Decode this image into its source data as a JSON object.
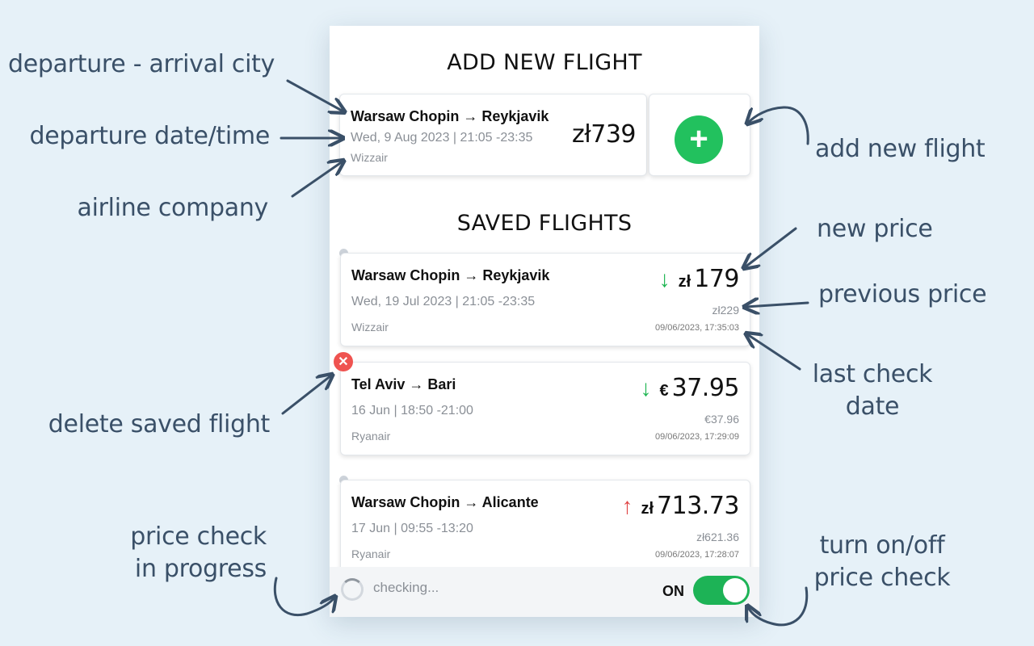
{
  "annotations": {
    "departure_arrival": "departure - arrival city",
    "departure_date": "departure date/time",
    "airline": "airline company",
    "delete": "delete saved flight",
    "in_progress_1": "price check",
    "in_progress_2": "in progress",
    "add_new": "add new flight",
    "new_price": "new price",
    "previous_price": "previous price",
    "last_check_1": "last check",
    "last_check_2": "date",
    "toggle_1": "turn on/off",
    "toggle_2": "price check"
  },
  "popup": {
    "add_heading": "ADD NEW FLIGHT",
    "saved_heading": "SAVED FLIGHTS",
    "new_flight": {
      "route": "Warsaw Chopin → Reykjavik",
      "date": "Wed, 9 Aug 2023 | 21:05 -23:35",
      "airline": "Wizzair",
      "price": "zł739"
    },
    "add_button_icon": "+",
    "saved": [
      {
        "route": "Warsaw Chopin → Reykjavik",
        "date": "Wed, 19 Jul 2023 | 21:05 -23:35",
        "airline": "Wizzair",
        "trend_icon": "↓",
        "trend": "down",
        "currency": "zł",
        "price": "179",
        "previous": "zł229",
        "checked": "09/06/2023, 17:35:03"
      },
      {
        "route": "Tel Aviv → Bari",
        "date": "16 Jun | 18:50 -21:00",
        "airline": "Ryanair",
        "trend_icon": "↓",
        "trend": "down",
        "currency": "€",
        "price": "37.95",
        "previous": "€37.96",
        "checked": "09/06/2023, 17:29:09"
      },
      {
        "route": "Warsaw Chopin → Alicante",
        "date": "17 Jun | 09:55 -13:20",
        "airline": "Ryanair",
        "trend_icon": "↑",
        "trend": "up",
        "currency": "zł",
        "price": "713.73",
        "previous": "zł621.36",
        "checked": "09/06/2023, 17:28:07"
      }
    ],
    "delete_icon": "✕",
    "footer": {
      "status": "checking...",
      "toggle_label": "ON",
      "toggle_on": true
    }
  },
  "colors": {
    "background": "#e6f1f8",
    "annotation": "#3a5068",
    "add_green": "#22c15e",
    "toggle_green": "#1db356",
    "trend_down": "#1fb552",
    "trend_up": "#e04545",
    "delete_red": "#ef5350"
  }
}
